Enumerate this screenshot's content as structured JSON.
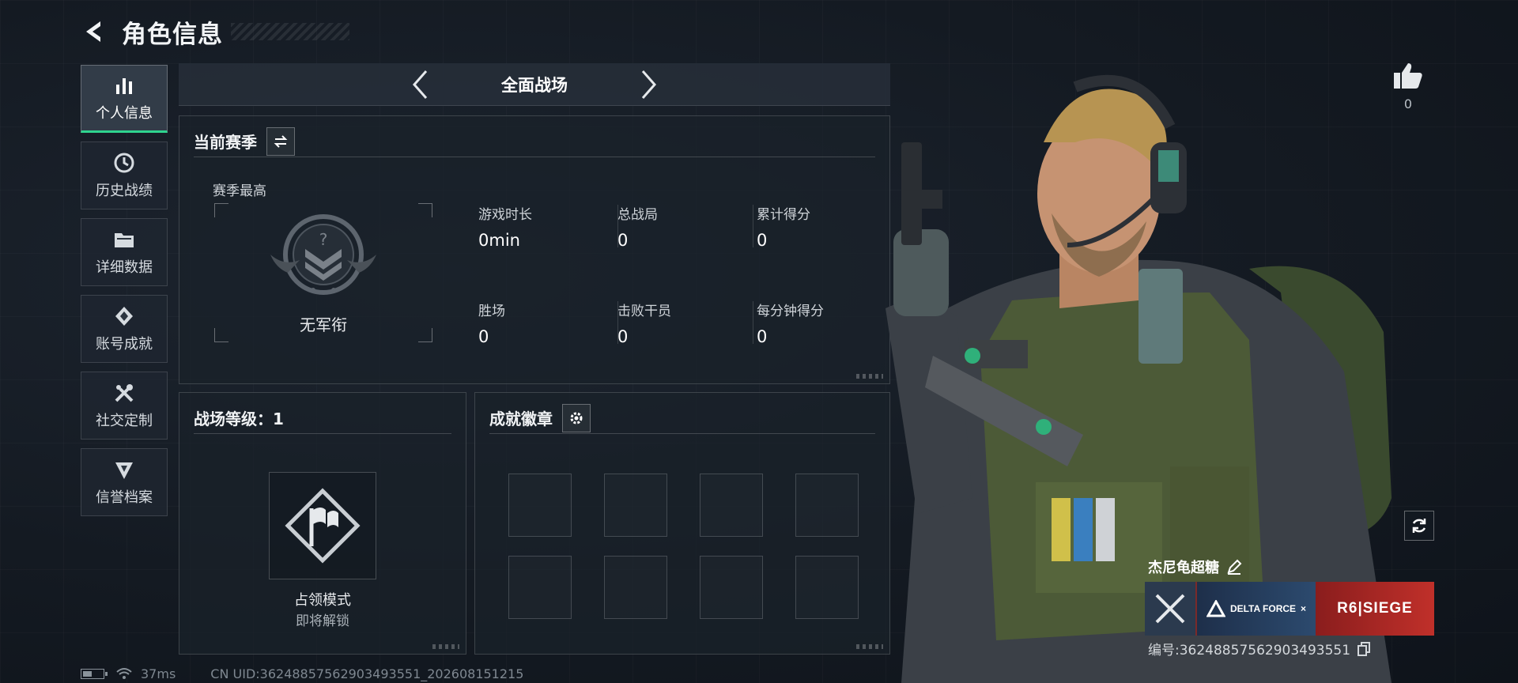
{
  "header": {
    "title": "角色信息"
  },
  "sidebar": {
    "items": [
      {
        "label": "个人信息",
        "icon": "bar-chart-icon",
        "active": true
      },
      {
        "label": "历史战绩",
        "icon": "history-icon",
        "active": false
      },
      {
        "label": "详细数据",
        "icon": "folder-icon",
        "active": false
      },
      {
        "label": "账号成就",
        "icon": "achievement-icon",
        "active": false
      },
      {
        "label": "社交定制",
        "icon": "tools-icon",
        "active": false
      },
      {
        "label": "信誉档案",
        "icon": "credibility-icon",
        "active": false
      }
    ]
  },
  "mode_bar": {
    "title": "全面战场"
  },
  "season": {
    "title": "当前赛季",
    "best_label": "赛季最高",
    "rank_name": "无军衔",
    "stats": [
      {
        "label": "游戏时长",
        "value": "0min"
      },
      {
        "label": "总战局",
        "value": "0"
      },
      {
        "label": "累计得分",
        "value": "0"
      },
      {
        "label": "胜场",
        "value": "0"
      },
      {
        "label": "击败干员",
        "value": "0"
      },
      {
        "label": "每分钟得分",
        "value": "0"
      }
    ]
  },
  "level": {
    "title": "战场等级：1",
    "mode_name": "占领模式",
    "mode_status": "即将解锁"
  },
  "badges": {
    "title": "成就徽章"
  },
  "profile": {
    "likes": "0",
    "player_name": "杰尼龟超糖",
    "player_id": "编号:3624885756290349355​1",
    "brand_left": "DELTA FORCE",
    "brand_x": "×",
    "brand_right": "R6|SIEGE"
  },
  "footer": {
    "ping": "37ms",
    "uid": "CN UID:36248857562903493551_202608151215"
  },
  "colors": {
    "accent": "#2fd48f",
    "background": "#141a22",
    "brand_red": "#c0302a"
  }
}
